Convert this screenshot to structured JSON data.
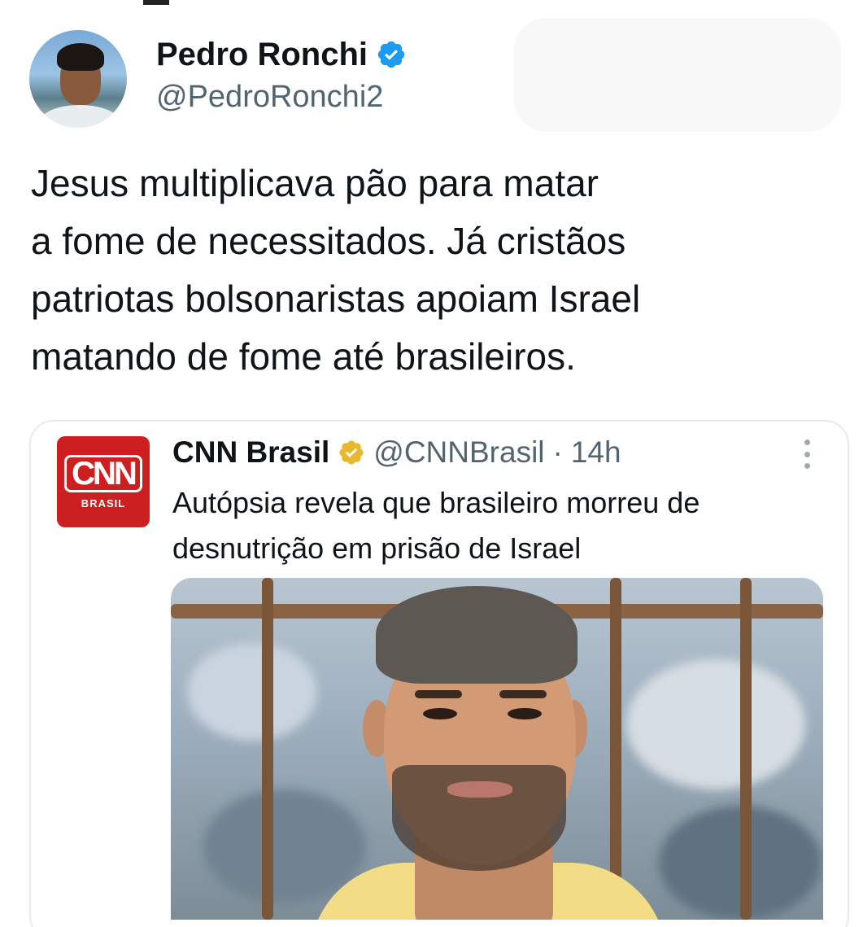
{
  "author": {
    "name": "Pedro Ronchi",
    "handle": "@PedroRonchi2",
    "verified": true
  },
  "tweet": {
    "text": "Jesus multiplicava pão para matar\na fome de necessitados. Já cristãos\npatriotas bolsonaristas apoiam Israel\nmatando de fome até brasileiros."
  },
  "quoted_tweet": {
    "logo": {
      "mark": "CNN",
      "sub": "BRASIL"
    },
    "name": "CNN Brasil",
    "verified": "gold",
    "handle": "@CNNBrasil",
    "separator": "·",
    "time": "14h",
    "text": "Autópsia revela que brasileiro morreu de\ndesnutrição em prisão de Israel"
  },
  "colors": {
    "verified_blue": "#1d9bf0",
    "verified_gold": "#e8b92f",
    "cnn_red": "#cc1f1f",
    "secondary_text": "#536471"
  },
  "icons": {
    "verified": "verified-badge-icon",
    "gold_verified": "gold-verified-badge-icon",
    "more": "more-options-icon"
  }
}
